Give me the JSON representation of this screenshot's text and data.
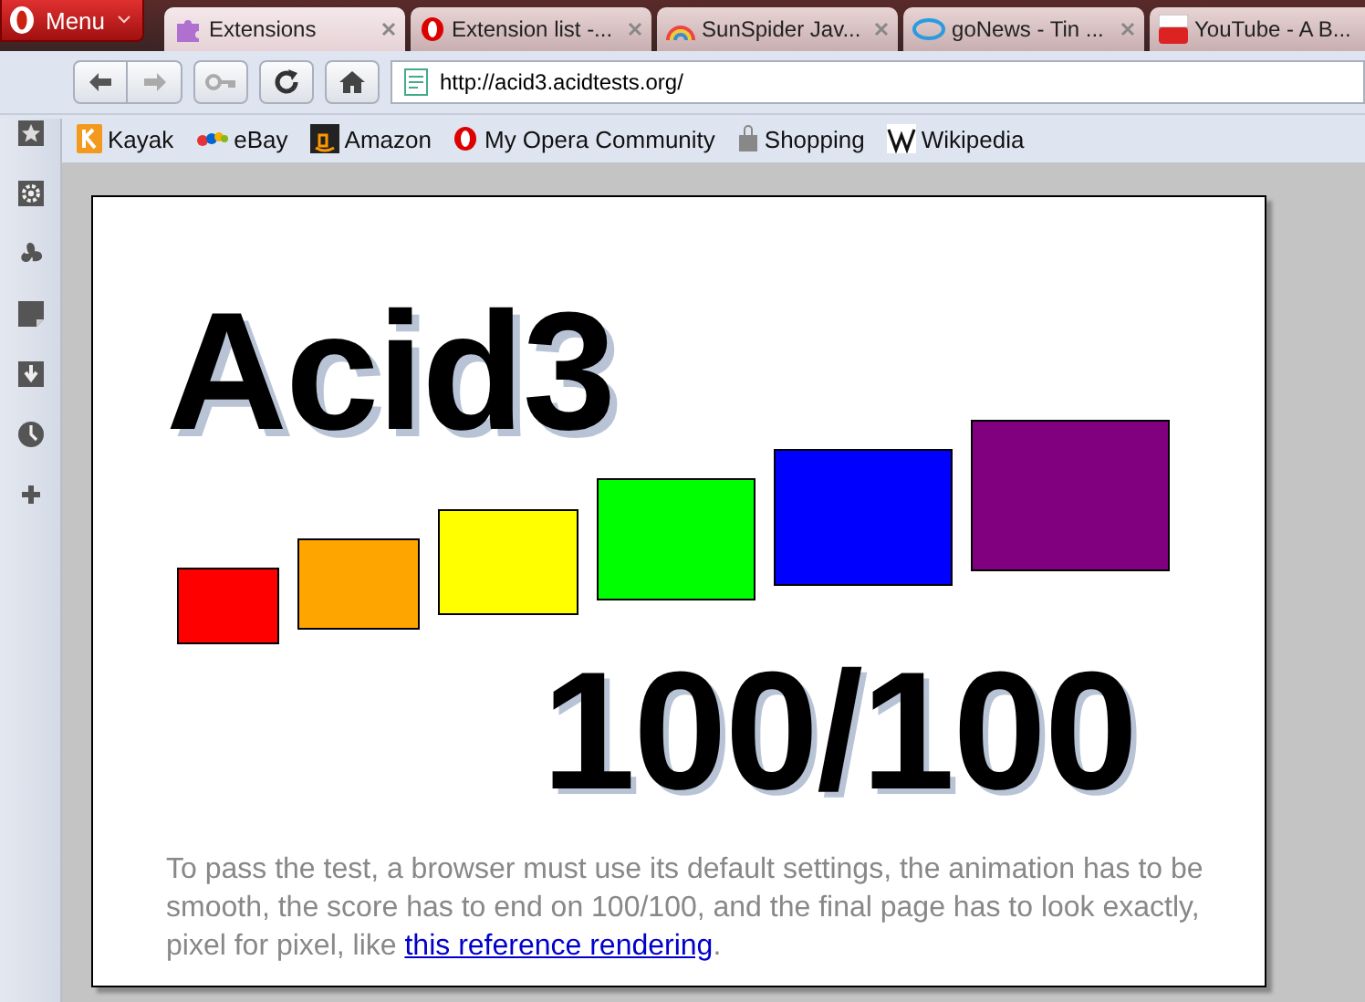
{
  "menu_button": {
    "label": "Menu"
  },
  "tabs": [
    {
      "label": "Extensions",
      "selected": true
    },
    {
      "label": "Extension list -...",
      "selected": false
    },
    {
      "label": "SunSpider Jav...",
      "selected": false
    },
    {
      "label": "goNews - Tin ...",
      "selected": false
    },
    {
      "label": "YouTube - A B...",
      "selected": false
    }
  ],
  "address_bar": {
    "value": "http://acid3.acidtests.org/"
  },
  "bookmarks": [
    {
      "label": "Kayak"
    },
    {
      "label": "eBay"
    },
    {
      "label": "Amazon"
    },
    {
      "label": "My Opera Community"
    },
    {
      "label": "Shopping"
    },
    {
      "label": "Wikipedia"
    }
  ],
  "page": {
    "title": "Acid3",
    "squares": [
      {
        "color": "#ff0000"
      },
      {
        "color": "#ffa500"
      },
      {
        "color": "#ffff00"
      },
      {
        "color": "#00ff00"
      },
      {
        "color": "#0000ff"
      },
      {
        "color": "#800080"
      }
    ],
    "score": "100/100",
    "description": "To pass the test, a browser must use its default settings, the animation has to be smooth, the score has to end on 100/100, and the final page has to look exactly, pixel for pixel, like ",
    "link": "this reference rendering",
    "after_link": "."
  }
}
